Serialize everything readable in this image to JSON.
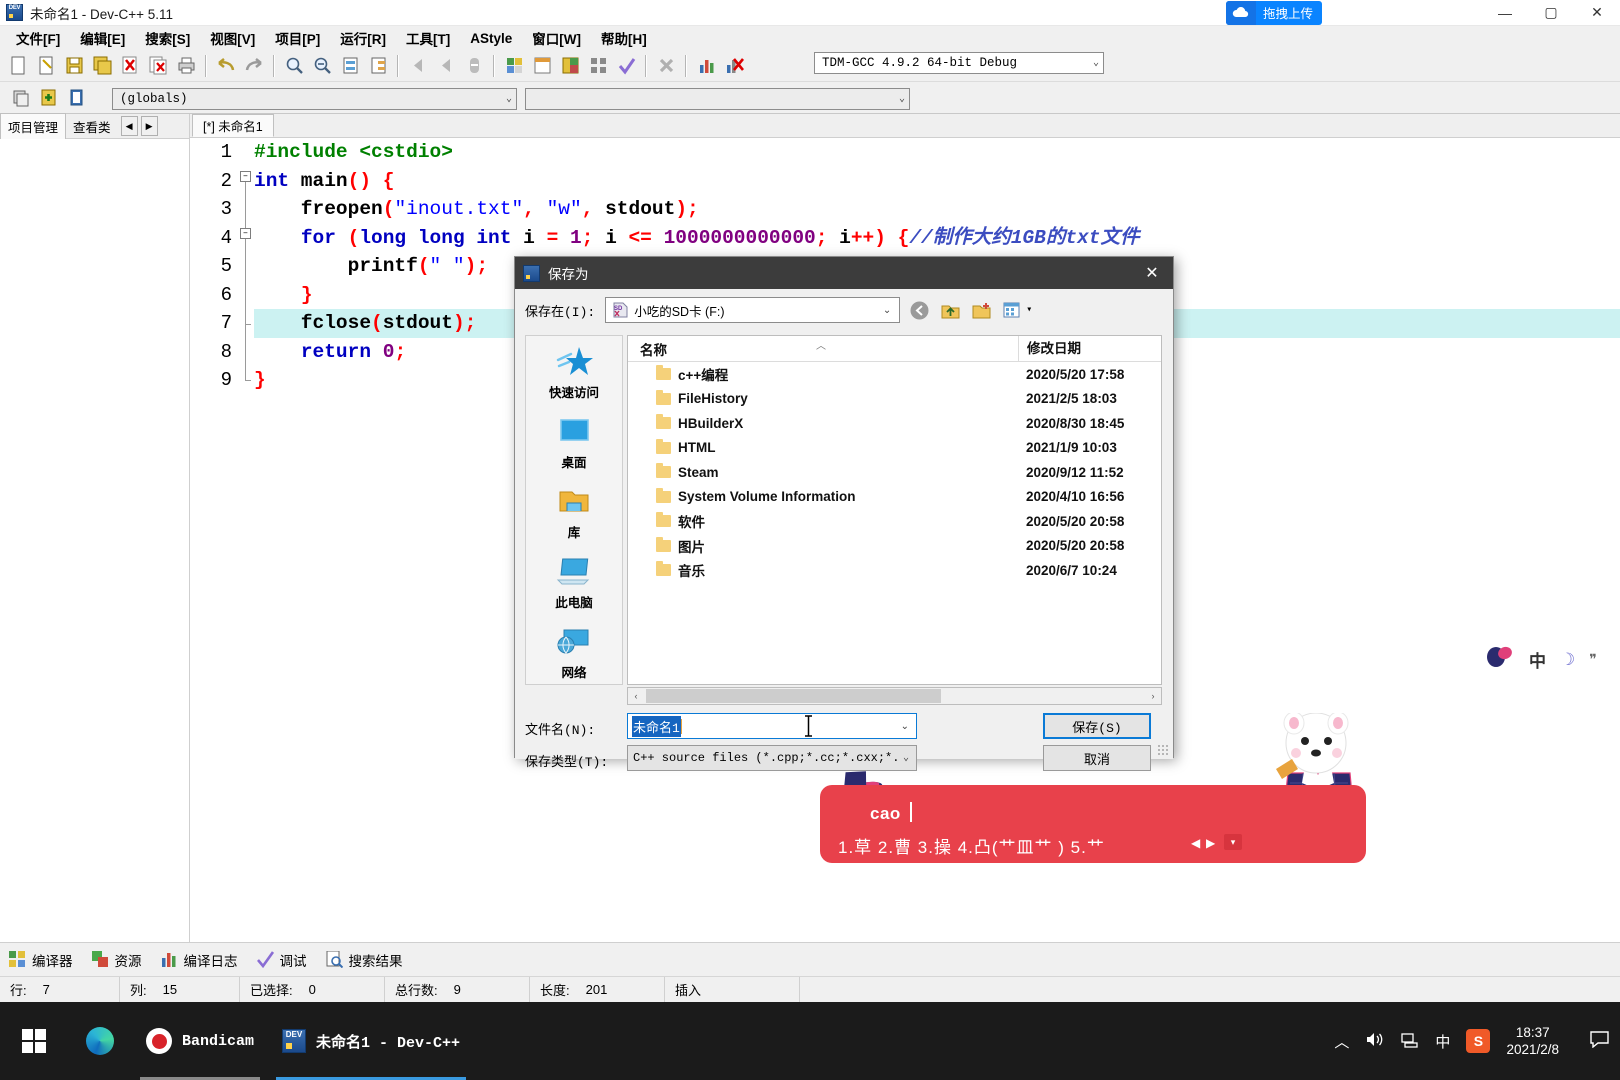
{
  "window": {
    "title": "未命名1 - Dev-C++ 5.11",
    "app_icon": "dev-cpp-icon",
    "upload_label": "拖拽上传",
    "upload_color": "#0a84ff",
    "minimize": "—",
    "maximize": "▢",
    "close": "✕"
  },
  "menubar": {
    "items": [
      {
        "label": "文件[F]"
      },
      {
        "label": "编辑[E]"
      },
      {
        "label": "搜索[S]"
      },
      {
        "label": "视图[V]"
      },
      {
        "label": "项目[P]"
      },
      {
        "label": "运行[R]"
      },
      {
        "label": "工具[T]"
      },
      {
        "label": "AStyle"
      },
      {
        "label": "窗口[W]"
      },
      {
        "label": "帮助[H]"
      }
    ]
  },
  "toolbar": {
    "compiler_value": "TDM-GCC 4.9.2 64-bit Debug",
    "globals_value": "(globals)",
    "members_value": "",
    "icons": [
      "new-file-icon",
      "open-file-icon",
      "save-icon",
      "save-all-icon",
      "close-file-icon",
      "close-all-icon",
      "print-icon",
      "undo-icon",
      "redo-icon",
      "find-icon",
      "replace-icon",
      "goto-line-icon",
      "indent-icon",
      "back-icon",
      "forward-icon",
      "insert-icon",
      "compile-icon",
      "run-icon",
      "compile-run-icon",
      "rebuild-icon",
      "syntax-check-icon",
      "stop-icon",
      "profile-icon",
      "delete-profile-icon"
    ],
    "row2_icons": [
      "project-new-icon",
      "project-add-icon",
      "project-remove-icon"
    ]
  },
  "left_panel": {
    "tabs": [
      {
        "label": "项目管理",
        "active": true
      },
      {
        "label": "查看类",
        "active": false
      }
    ],
    "scroll_left": "◀",
    "scroll_right": "▶"
  },
  "editor": {
    "tab_label": "[*] 未命名1",
    "highlight_line": 7,
    "line_numbers": [
      "1",
      "2",
      "3",
      "4",
      "5",
      "6",
      "7",
      "8",
      "9"
    ],
    "lines": [
      {
        "n": 1,
        "tokens": [
          {
            "t": "#include ",
            "c": "pp"
          },
          {
            "t": "<cstdio>",
            "c": "pp"
          }
        ]
      },
      {
        "n": 2,
        "tokens": [
          {
            "t": "int",
            "c": "k"
          },
          {
            "t": " main",
            "c": "id"
          },
          {
            "t": "()",
            "c": "p"
          },
          {
            "t": " ",
            "c": "id"
          },
          {
            "t": "{",
            "c": "p"
          }
        ]
      },
      {
        "n": 3,
        "tokens": [
          {
            "t": "    freopen",
            "c": "id"
          },
          {
            "t": "(",
            "c": "p"
          },
          {
            "t": "\"inout.txt\"",
            "c": "s"
          },
          {
            "t": ",",
            "c": "p"
          },
          {
            "t": " ",
            "c": "id"
          },
          {
            "t": "\"w\"",
            "c": "s"
          },
          {
            "t": ",",
            "c": "p"
          },
          {
            "t": " stdout",
            "c": "id"
          },
          {
            "t": ")",
            "c": "p"
          },
          {
            "t": ";",
            "c": "p"
          }
        ]
      },
      {
        "n": 4,
        "tokens": [
          {
            "t": "    ",
            "c": "id"
          },
          {
            "t": "for",
            "c": "k"
          },
          {
            "t": " ",
            "c": "id"
          },
          {
            "t": "(",
            "c": "p"
          },
          {
            "t": "long long int",
            "c": "k"
          },
          {
            "t": " i ",
            "c": "id"
          },
          {
            "t": "=",
            "c": "p"
          },
          {
            "t": " ",
            "c": "id"
          },
          {
            "t": "1",
            "c": "n"
          },
          {
            "t": ";",
            "c": "p"
          },
          {
            "t": " i ",
            "c": "id"
          },
          {
            "t": "<=",
            "c": "p"
          },
          {
            "t": " ",
            "c": "id"
          },
          {
            "t": "1000000000000",
            "c": "n"
          },
          {
            "t": ";",
            "c": "p"
          },
          {
            "t": " i",
            "c": "id"
          },
          {
            "t": "++",
            "c": "p"
          },
          {
            "t": ")",
            "c": "p"
          },
          {
            "t": " ",
            "c": "id"
          },
          {
            "t": "{",
            "c": "p"
          },
          {
            "t": "//制作大约1GB的txt文件",
            "c": "cm"
          }
        ]
      },
      {
        "n": 5,
        "tokens": [
          {
            "t": "        printf",
            "c": "id"
          },
          {
            "t": "(",
            "c": "p"
          },
          {
            "t": "\" \"",
            "c": "s"
          },
          {
            "t": ")",
            "c": "p"
          },
          {
            "t": ";",
            "c": "p"
          }
        ]
      },
      {
        "n": 6,
        "tokens": [
          {
            "t": "    ",
            "c": "id"
          },
          {
            "t": "}",
            "c": "p"
          }
        ]
      },
      {
        "n": 7,
        "tokens": [
          {
            "t": "    fclose",
            "c": "id"
          },
          {
            "t": "(",
            "c": "p"
          },
          {
            "t": "stdout",
            "c": "id"
          },
          {
            "t": ")",
            "c": "p"
          },
          {
            "t": ";",
            "c": "p"
          }
        ]
      },
      {
        "n": 8,
        "tokens": [
          {
            "t": "    ",
            "c": "id"
          },
          {
            "t": "return",
            "c": "k"
          },
          {
            "t": " ",
            "c": "id"
          },
          {
            "t": "0",
            "c": "n"
          },
          {
            "t": ";",
            "c": "p"
          }
        ]
      },
      {
        "n": 9,
        "tokens": [
          {
            "t": "}",
            "c": "p"
          }
        ]
      }
    ]
  },
  "dialog": {
    "title": "保存为",
    "close": "✕",
    "look_in_label": "保存在(I):",
    "look_in_value": "小吃的SD卡 (F:)",
    "look_in_icon": "sd-card-icon",
    "nav_icons": [
      "back-icon",
      "up-folder-icon",
      "new-folder-icon",
      "view-mode-icon"
    ],
    "view_dropdown": "▾",
    "places": [
      {
        "label": "快速访问",
        "icon": "star-icon"
      },
      {
        "label": "桌面",
        "icon": "desktop-icon"
      },
      {
        "label": "库",
        "icon": "library-folder-icon"
      },
      {
        "label": "此电脑",
        "icon": "this-pc-icon"
      },
      {
        "label": "网络",
        "icon": "network-icon"
      }
    ],
    "columns": [
      "名称",
      "修改日期"
    ],
    "sort_indicator": "︿",
    "files": [
      {
        "name": "c++编程",
        "date": "2020/5/20 17:58"
      },
      {
        "name": "FileHistory",
        "date": "2021/2/5 18:03"
      },
      {
        "name": "HBuilderX",
        "date": "2020/8/30 18:45"
      },
      {
        "name": "HTML",
        "date": "2021/1/9 10:03"
      },
      {
        "name": "Steam",
        "date": "2020/9/12 11:52"
      },
      {
        "name": "System Volume Information",
        "date": "2020/4/10 16:56"
      },
      {
        "name": "软件",
        "date": "2020/5/20 20:58"
      },
      {
        "name": "图片",
        "date": "2020/5/20 20:58"
      },
      {
        "name": "音乐",
        "date": "2020/6/7 10:24"
      }
    ],
    "scroll_left": "‹",
    "scroll_right": "›",
    "filename_label": "文件名(N):",
    "filename_value": "未命名1",
    "filetype_label": "保存类型(T):",
    "filetype_value": "C++ source files (*.cpp;*.cc;*.cxx;*.",
    "save_button": "保存(S)",
    "cancel_button": "取消",
    "dropdown_arrow": "⌄"
  },
  "ime": {
    "typed": "cao",
    "candidates": "1.草  2.曹  3.操  4.凸(艹皿艹 )  5.艹",
    "prev_arrow": "◀",
    "next_arrow": "▶",
    "expand_arrow": "▾",
    "bar_color": "#e8414b"
  },
  "ime_status": {
    "mode": "中",
    "moon": "☽",
    "quote": "❞"
  },
  "bottom_panel": {
    "items": [
      {
        "label": "编译器",
        "icon": "compiler-icon"
      },
      {
        "label": "资源",
        "icon": "resource-icon"
      },
      {
        "label": "编译日志",
        "icon": "compile-log-icon"
      },
      {
        "label": "调试",
        "icon": "debug-icon"
      },
      {
        "label": "搜索结果",
        "icon": "search-results-icon"
      }
    ]
  },
  "statusbar": {
    "cells": [
      {
        "label": "行:",
        "value": "7"
      },
      {
        "label": "列:",
        "value": "15"
      },
      {
        "label": "已选择:",
        "value": "0"
      },
      {
        "label": "总行数:",
        "value": "9"
      },
      {
        "label": "长度:",
        "value": "201"
      },
      {
        "label": "插入",
        "value": ""
      }
    ]
  },
  "taskbar": {
    "start_icon": "windows-start-icon",
    "items": [
      {
        "label": "",
        "icon": "edge-icon",
        "state": ""
      },
      {
        "label": "Bandicam",
        "icon": "bandicam-icon",
        "state": "open"
      },
      {
        "label": "未命名1 - Dev-C++",
        "icon": "dev-cpp-icon",
        "state": "active"
      }
    ],
    "tray": [
      {
        "icon": "show-hidden-icons-chevron",
        "glyph": "︿"
      },
      {
        "icon": "volume-icon",
        "glyph": "🔊"
      },
      {
        "icon": "network-icon",
        "glyph": "⌸"
      },
      {
        "icon": "ime-mode-icon",
        "glyph": "中"
      },
      {
        "icon": "sogou-icon",
        "glyph": "S"
      }
    ],
    "clock_time": "18:37",
    "clock_date": "2021/2/8",
    "notification_icon": "notification-icon"
  }
}
